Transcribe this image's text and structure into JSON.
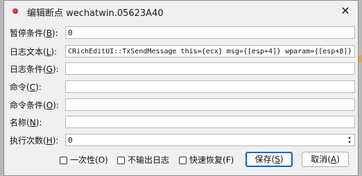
{
  "window": {
    "title": "编辑断点 wechatwin.05623A40"
  },
  "fields": [
    {
      "label": "暂停条件(",
      "key": "B",
      "label_end": "):",
      "value": "0"
    },
    {
      "label": "日志文本(",
      "key": "L",
      "label_end": "):",
      "value": "CRichEditUI::TxSendMessage this={ecx} msg={[esp+4]} wparam={[esp+8]}"
    },
    {
      "label": "日志条件(",
      "key": "G",
      "label_end": "):",
      "value": ""
    },
    {
      "label": "命令(",
      "key": "C",
      "label_end": "):",
      "value": ""
    },
    {
      "label": "命令条件(",
      "key": "O",
      "label_end": "):",
      "value": ""
    },
    {
      "label": "名称(",
      "key": "N",
      "label_end": "):",
      "value": ""
    },
    {
      "label": "执行次数(",
      "key": "H",
      "label_end": "):",
      "value": "0"
    }
  ],
  "options": [
    {
      "label": "一次性(",
      "key": "O",
      "label_end": ")",
      "checked": false
    },
    {
      "label": "不输出日志",
      "key": "",
      "label_end": "",
      "checked": false
    },
    {
      "label": "快速恢复(",
      "key": "F",
      "label_end": ")",
      "checked": false
    }
  ],
  "buttons": {
    "save": {
      "label": "保存(",
      "key": "S",
      "label_end": ")"
    },
    "cancel": {
      "label": "取消(",
      "key": "A",
      "label_end": ")"
    }
  }
}
